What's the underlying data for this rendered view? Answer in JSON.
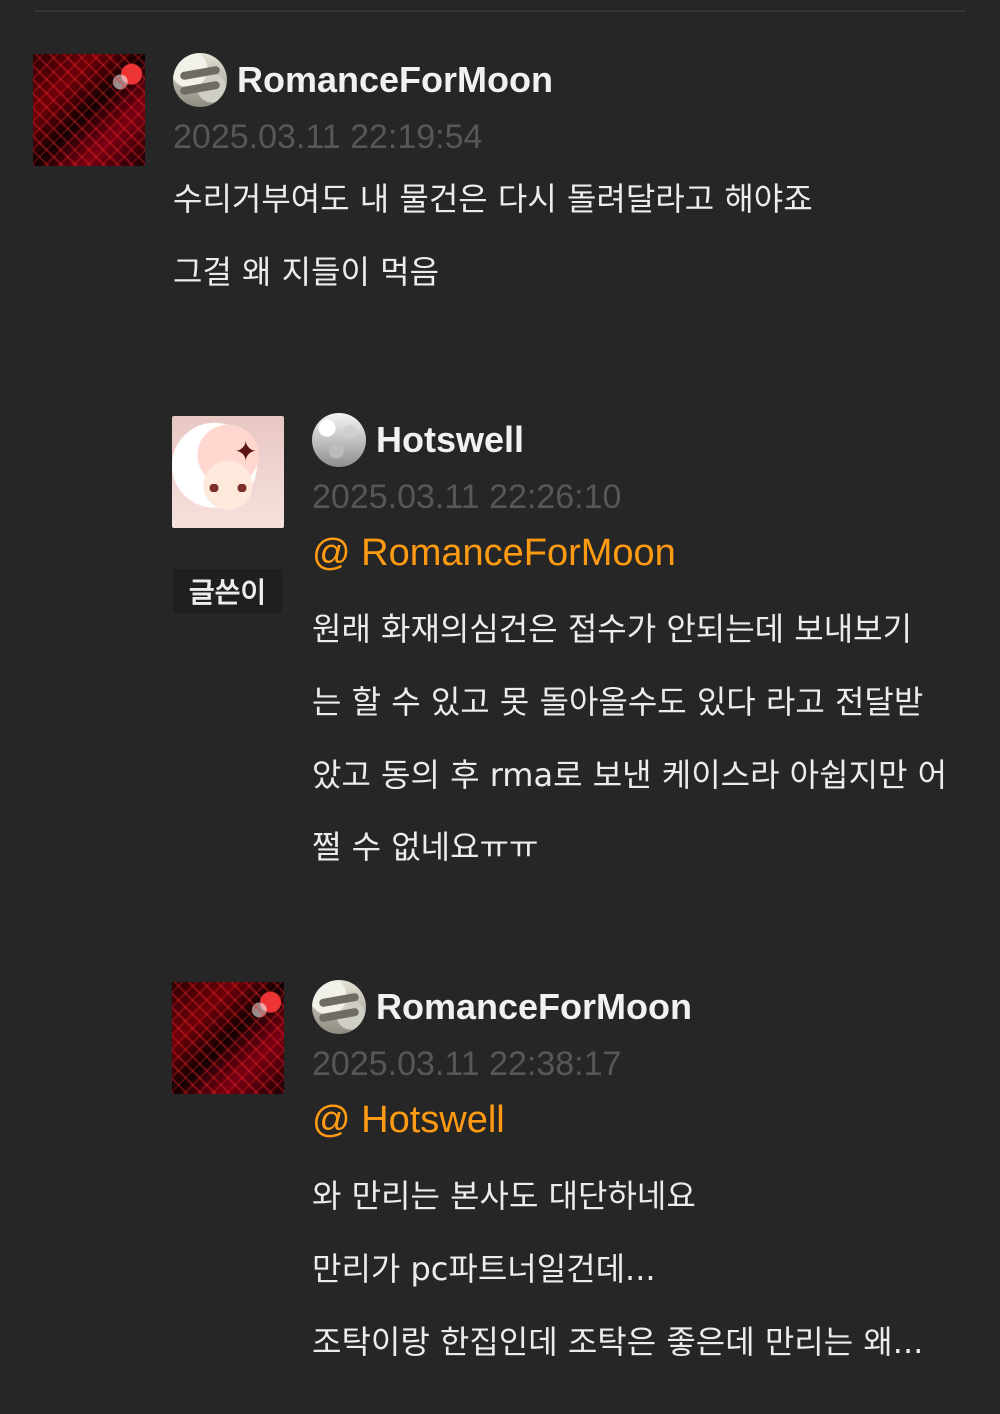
{
  "comments": [
    {
      "username": "RomanceForMoon",
      "timestamp": "2025.03.11 22:19:54",
      "lines": [
        "수리거부여도 내 물건은 다시 돌려달라고 해야죠",
        "그걸 왜 지들이 먹음"
      ]
    },
    {
      "username": "Hotswell",
      "timestamp": "2025.03.11 22:26:10",
      "mention": "@ RomanceForMoon",
      "badge": "글쓴이",
      "lines": [
        "원래 화재의심건은 접수가 안되는데 보내보기",
        "는 할 수 있고 못 돌아올수도 있다 라고 전달받",
        "았고 동의 후 rma로 보낸 케이스라 아쉽지만 어",
        "쩔 수 없네요ㅠㅠ"
      ]
    },
    {
      "username": "RomanceForMoon",
      "timestamp": "2025.03.11 22:38:17",
      "mention": "@ Hotswell",
      "lines": [
        "와 만리는 본사도 대단하네요",
        "만리가 pc파트너일건데...",
        "조탁이랑 한집인데 조탁은 좋은데 만리는 왜..."
      ]
    }
  ]
}
